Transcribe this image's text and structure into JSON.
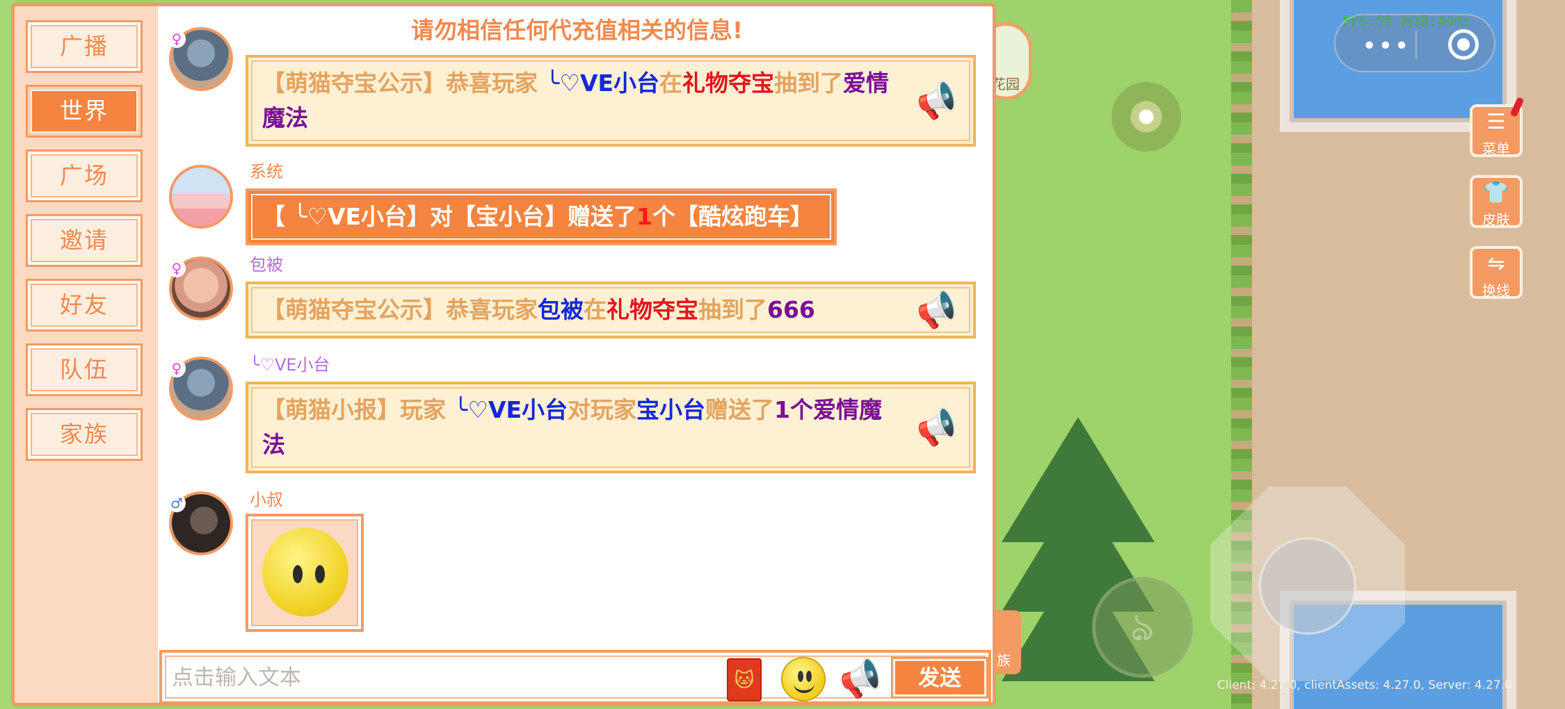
{
  "notice": "请勿相信任何代充值相关的信息!",
  "tabs": [
    {
      "label": "广播",
      "active": false
    },
    {
      "label": "世界",
      "active": true
    },
    {
      "label": "广场",
      "active": false
    },
    {
      "label": "邀请",
      "active": false
    },
    {
      "label": "好友",
      "active": false
    },
    {
      "label": "队伍",
      "active": false
    },
    {
      "label": "家族",
      "active": false
    }
  ],
  "messages": [
    {
      "user": "",
      "gender": "♀",
      "segments": [
        {
          "text": "【萌猫夺宝公示】恭喜玩家 ",
          "color": "orange"
        },
        {
          "text": "╰♡VE小台",
          "color": "blue"
        },
        {
          "text": "在",
          "color": "orange"
        },
        {
          "text": "礼物夺宝",
          "color": "red"
        },
        {
          "text": "抽到了",
          "color": "orange"
        },
        {
          "text": "爱情魔法",
          "color": "purple"
        }
      ]
    },
    {
      "user": "系统",
      "gender": "",
      "segments": [
        {
          "text": "【 ╰♡VE小台】对【宝小台】赠送了",
          "color": "white"
        },
        {
          "text": "1",
          "color": "redsys"
        },
        {
          "text": "个【酷炫跑车】",
          "color": "white"
        }
      ]
    },
    {
      "user": "包被",
      "gender": "♀",
      "segments": [
        {
          "text": "【萌猫夺宝公示】恭喜玩家",
          "color": "orange"
        },
        {
          "text": "包被",
          "color": "blue"
        },
        {
          "text": "在",
          "color": "orange"
        },
        {
          "text": "礼物夺宝",
          "color": "red"
        },
        {
          "text": "抽到了",
          "color": "orange"
        },
        {
          "text": "666",
          "color": "purple"
        }
      ]
    },
    {
      "user": "╰♡VE小台",
      "gender": "♀",
      "segments": [
        {
          "text": "【萌猫小报】玩家 ",
          "color": "orange"
        },
        {
          "text": "╰♡VE小台",
          "color": "blue"
        },
        {
          "text": "对玩家",
          "color": "orange"
        },
        {
          "text": "宝小台",
          "color": "blue"
        },
        {
          "text": "赠送了",
          "color": "orange"
        },
        {
          "text": "1个爱情魔法",
          "color": "purple"
        }
      ]
    },
    {
      "user": "小叔",
      "gender": "♂",
      "sticker": "smiley-sticker"
    }
  ],
  "input": {
    "placeholder": "点击输入文本",
    "value": ""
  },
  "send_label": "发送",
  "hud": {
    "fps": "FPS:55  网络:44ms",
    "garden_label": "花园",
    "clan_label": "族",
    "menu_label": "菜单",
    "skin_label": "皮肤",
    "switch_label": "换线",
    "version": "Client: 4.27.0, clientAssets: 4.27.0, Server: 4.27.0"
  },
  "icons": {
    "horn": "megaphone-icon",
    "redpacket": "red-envelope-icon",
    "emoji": "emoji-icon",
    "menu": "list-icon",
    "skin": "shirt-icon",
    "switch": "swap-icon"
  },
  "colors": {
    "accent": "#f4843f",
    "username_system": "#f3894e",
    "username_female": "#b46be0",
    "blue": "#1427d9",
    "red": "#e5141c",
    "purple": "#7a0f9a"
  }
}
